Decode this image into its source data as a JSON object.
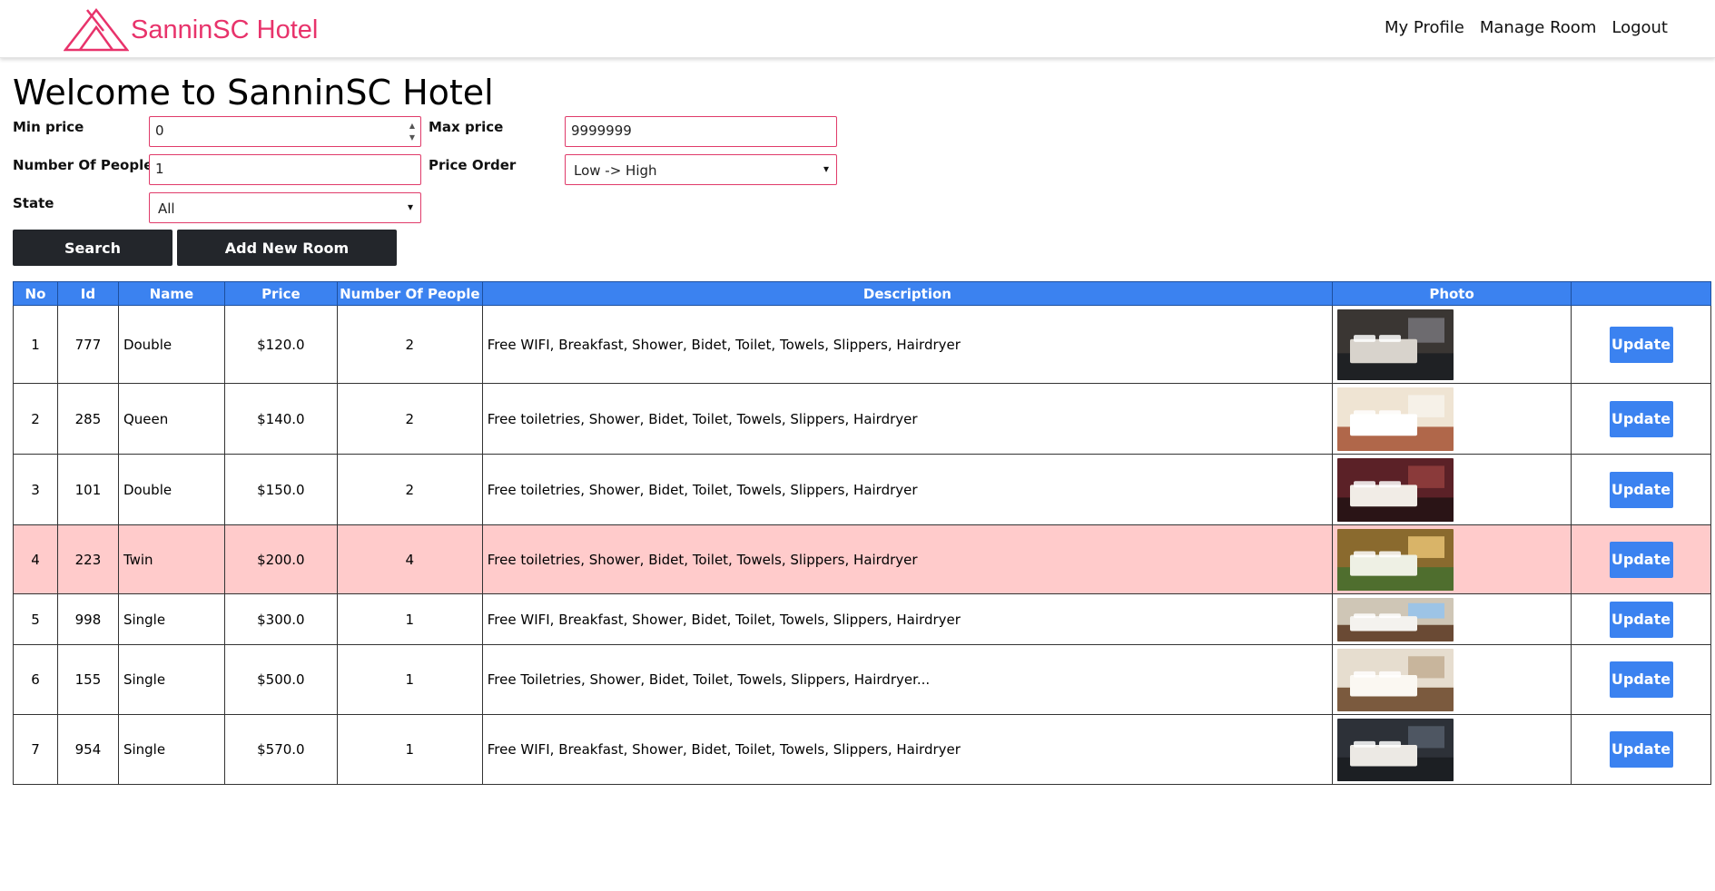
{
  "brand": {
    "name": "SanninSC Hotel",
    "color": "#e8336b"
  },
  "nav": {
    "my_profile": "My Profile",
    "manage_room": "Manage Room",
    "logout": "Logout"
  },
  "page": {
    "title": "Welcome to SanninSC Hotel"
  },
  "filters": {
    "min_price": {
      "label": "Min price",
      "value": "0"
    },
    "max_price": {
      "label": "Max price",
      "value": "9999999"
    },
    "people": {
      "label": "Number Of People",
      "value": "1"
    },
    "price_order": {
      "label": "Price Order",
      "value": "Low -> High"
    },
    "state": {
      "label": "State",
      "value": "All"
    }
  },
  "buttons": {
    "search": "Search",
    "add_room": "Add New Room"
  },
  "table": {
    "headers": [
      "No",
      "Id",
      "Name",
      "Price",
      "Number Of People",
      "Description",
      "Photo",
      ""
    ],
    "update_label": "Update",
    "rows": [
      {
        "no": "1",
        "id": "777",
        "name": "Double",
        "price": "$120.0",
        "people": "2",
        "description": "Free WIFI, Breakfast, Shower, Bidet, Toilet, Towels, Slippers, Hairdryer",
        "highlight": false,
        "photo": "modern-hotel-room-dark"
      },
      {
        "no": "2",
        "id": "285",
        "name": "Queen",
        "price": "$140.0",
        "people": "2",
        "description": "Free toiletries, Shower, Bidet, Toilet, Towels, Slippers, Hairdryer",
        "highlight": false,
        "photo": "bright-queen-room"
      },
      {
        "no": "3",
        "id": "101",
        "name": "Double",
        "price": "$150.0",
        "people": "2",
        "description": "Free toiletries, Shower, Bidet, Toilet, Towels, Slippers, Hairdryer",
        "highlight": false,
        "photo": "maroon-double-room"
      },
      {
        "no": "4",
        "id": "223",
        "name": "Twin",
        "price": "$200.0",
        "people": "4",
        "description": "Free toiletries, Shower, Bidet, Toilet, Towels, Slippers, Hairdryer",
        "highlight": true,
        "photo": "warm-twin-room"
      },
      {
        "no": "5",
        "id": "998",
        "name": "Single",
        "price": "$300.0",
        "people": "1",
        "description": "Free WIFI, Breakfast, Shower, Bidet, Toilet, Towels, Slippers, Hairdryer",
        "highlight": false,
        "photo": "single-room-window"
      },
      {
        "no": "6",
        "id": "155",
        "name": "Single",
        "price": "$500.0",
        "people": "1",
        "description": "Free Toiletries, Shower, Bidet, Toilet, Towels, Slippers, Hairdryer...",
        "highlight": false,
        "photo": "single-room-light"
      },
      {
        "no": "7",
        "id": "954",
        "name": "Single",
        "price": "$570.0",
        "people": "1",
        "description": "Free WIFI, Breakfast, Shower, Bidet, Toilet, Towels, Slippers, Hairdryer",
        "highlight": false,
        "photo": "single-room-two-beds"
      }
    ]
  },
  "colors": {
    "accent": "#3b82f0",
    "highlight_row": "#ffcbcb",
    "dark_button": "#23262b",
    "input_border": "#e03b6a"
  }
}
